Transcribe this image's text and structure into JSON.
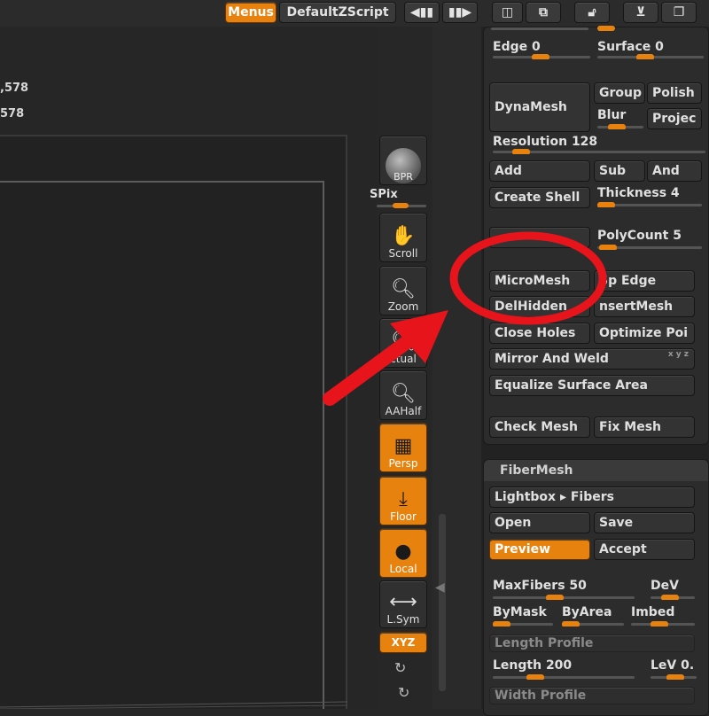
{
  "topbar": {
    "menus": "Menus",
    "script": "DefaultZScript"
  },
  "viewport": {
    "stat1": ",578",
    "stat2": "578"
  },
  "shelf": {
    "bpr": "BPR",
    "spix": "SPix",
    "scroll": "Scroll",
    "zoom": "Zoom",
    "actual": "ctual",
    "aahalf": "AAHalf",
    "persp": "Persp",
    "floor": "Floor",
    "local": "Local",
    "lsym": "L.Sym",
    "xyz": "XYZ"
  },
  "geometry": {
    "edge": "Edge 0",
    "surface": "Surface 0",
    "dynamesh": "DynaMesh",
    "group": "Group",
    "polish": "Polish",
    "blur": "Blur",
    "project": "Projec",
    "resolution": "Resolution 128",
    "add": "Add",
    "sub": "Sub",
    "and": "And",
    "create_shell": "Create Shell",
    "thickness": "Thickness 4",
    "polycount": "PolyCount 5",
    "micromesh": "MicroMesh",
    "split_edge": "Sp   Edge",
    "delhidden": "DelHidden",
    "insertmesh": "nsertMesh",
    "close_holes": "Close Holes",
    "optimize": "Optimize Poi",
    "mirror_weld": "Mirror And Weld",
    "equalize": "Equalize Surface Area",
    "check_mesh": "Check Mesh",
    "fix_mesh": "Fix Mesh"
  },
  "fibermesh": {
    "title": "FiberMesh",
    "lightbox": "Lightbox ▸ Fibers",
    "open": "Open",
    "save": "Save",
    "preview": "Preview",
    "accept": "Accept",
    "maxfibers": "MaxFibers 50",
    "dev": "DeV",
    "bymask": "ByMask",
    "byarea": "ByArea",
    "imbed": "Imbed",
    "length_profile": "Length Profile",
    "length": "Length 200",
    "lev": "LeV 0.",
    "width_profile": "Width Profile"
  },
  "colors": {
    "accent": "#e8820f",
    "annotation": "#e8141b"
  }
}
